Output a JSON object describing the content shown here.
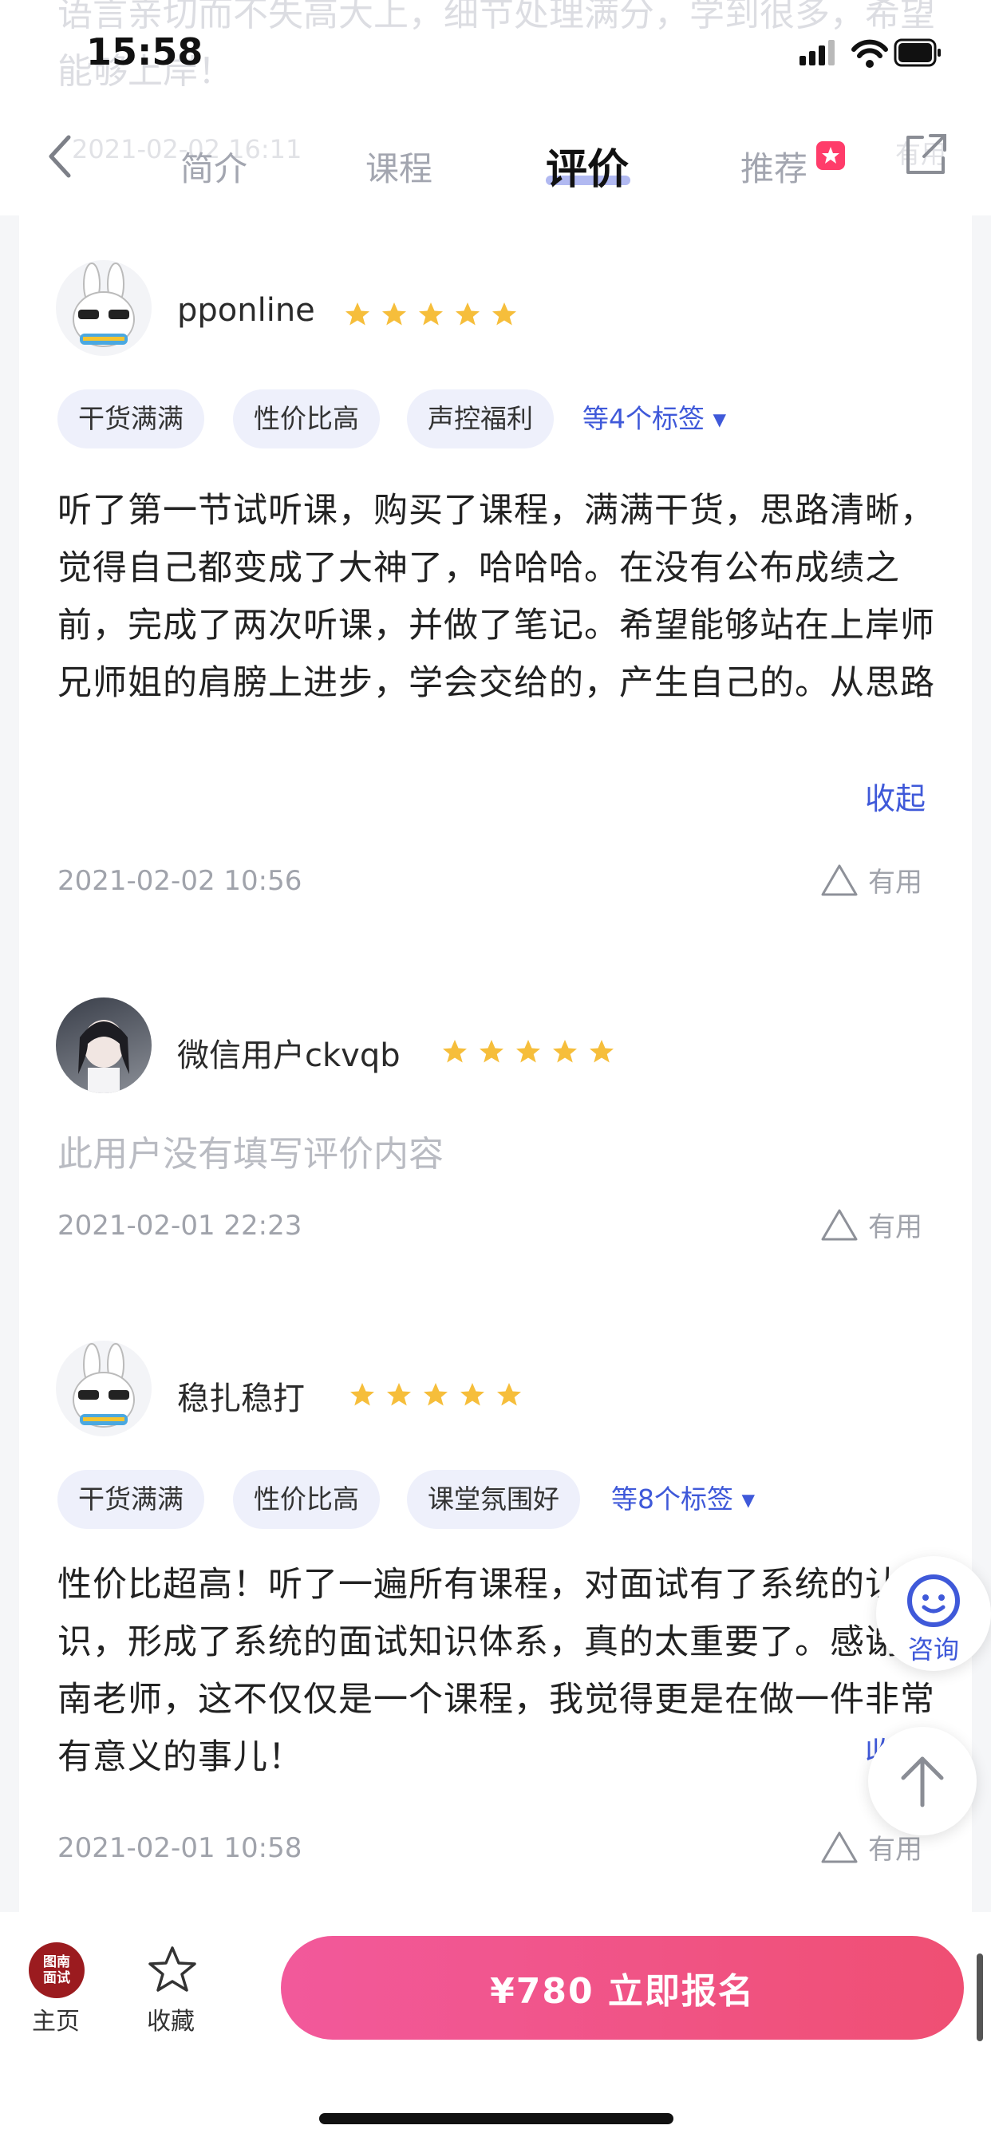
{
  "status": {
    "time": "15:58"
  },
  "header": {
    "ghost_text": "语言亲切而不失高大上，细节处理满分，学到很多，希望能够上岸！",
    "ghost_date": "2021-02-02 16:11",
    "ghost_useful": "有用",
    "tabs": [
      "简介",
      "课程",
      "评价",
      "推荐"
    ]
  },
  "reviews": [
    {
      "username": "pponline",
      "rating": 5,
      "tags": [
        "干货满满",
        "性价比高",
        "声控福利"
      ],
      "more_tags": "等4个标签",
      "content": "听了第一节试听课，购买了课程，满满干货，思路清晰，觉得自己都变成了大神了，哈哈哈。在没有公布成绩之前，完成了两次听课，并做了笔记。希望能够站在上岸师兄师姐的肩膀上进步，学会交给的，产生自己的。从思路到开口，再到巩固方法。今天开始试讲，加油嘿~",
      "collapse_label": "收起",
      "date": "2021-02-02 10:56",
      "useful_label": "有用"
    },
    {
      "username": "微信用户ckvqb",
      "rating": 5,
      "empty_text": "此用户没有填写评价内容",
      "date": "2021-02-01 22:23",
      "useful_label": "有用"
    },
    {
      "username": "稳扎稳打",
      "rating": 5,
      "tags": [
        "干货满满",
        "性价比高",
        "课堂氛围好"
      ],
      "more_tags": "等8个标签",
      "content": "性价比超高！听了一遍所有课程，对面试有了系统的认识，形成了系统的面试知识体系，真的太重要了。感谢图南老师，这不仅仅是一个课程，我觉得更是在做一件非常有意义的事儿！",
      "collapse_label": "收起",
      "date": "2021-02-01 10:58",
      "useful_label": "有用"
    }
  ],
  "floating": {
    "consult_label": "咨询"
  },
  "bottom_bar": {
    "home_logo_text": "图南面试",
    "home_label": "主页",
    "fav_label": "收藏",
    "cta_label": "¥780 立即报名"
  },
  "colors": {
    "accent": "#3f59d9",
    "cta_start": "#f2599b",
    "cta_end": "#ef4f73",
    "star": "#f6be3b"
  }
}
